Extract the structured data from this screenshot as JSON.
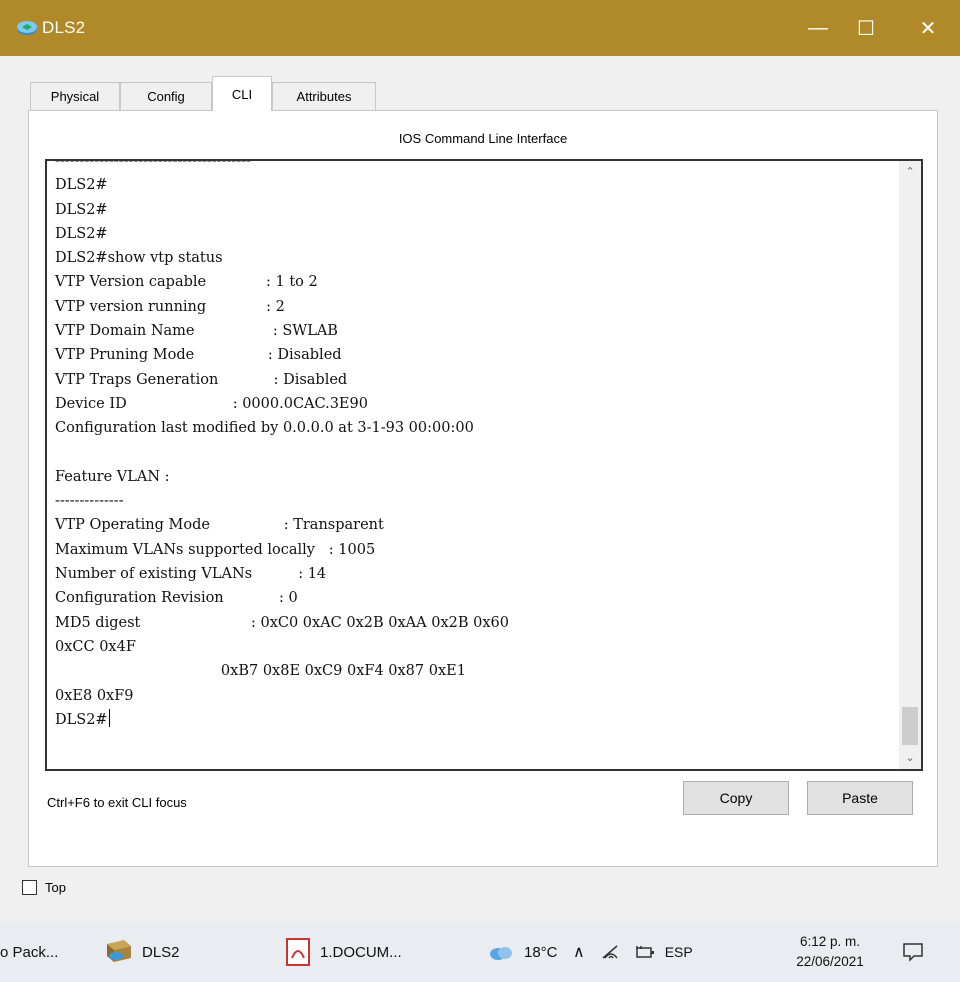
{
  "window": {
    "title": "DLS2",
    "minimize_glyph": "—",
    "maximize_glyph": "☐",
    "close_glyph": "✕"
  },
  "tabs": [
    {
      "label": "Physical",
      "active": false
    },
    {
      "label": "Config",
      "active": false
    },
    {
      "label": "CLI",
      "active": true
    },
    {
      "label": "Attributes",
      "active": false
    }
  ],
  "cli": {
    "heading": "IOS Command Line Interface",
    "lines": [
      "----------------------------------------",
      "DLS2#",
      "DLS2#",
      "DLS2#",
      "DLS2#show vtp status",
      "VTP Version capable             : 1 to 2",
      "VTP version running             : 2",
      "VTP Domain Name                 : SWLAB",
      "VTP Pruning Mode                : Disabled",
      "VTP Traps Generation            : Disabled",
      "Device ID                       : 0000.0CAC.3E90",
      "Configuration last modified by 0.0.0.0 at 3-1-93 00:00:00",
      "",
      "Feature VLAN :",
      "--------------",
      "VTP Operating Mode                : Transparent",
      "Maximum VLANs supported locally   : 1005",
      "Number of existing VLANs          : 14",
      "Configuration Revision            : 0",
      "MD5 digest                        : 0xC0 0xAC 0x2B 0xAA 0x2B 0x60",
      "0xCC 0x4F",
      "                                    0xB7 0x8E 0xC9 0xF4 0x87 0xE1",
      "0xE8 0xF9",
      "DLS2#"
    ],
    "hint": "Ctrl+F6 to exit CLI focus",
    "copy_label": "Copy",
    "paste_label": "Paste"
  },
  "top_checkbox": {
    "label": "Top",
    "checked": false
  },
  "taskbar": {
    "items": [
      {
        "label": "o Pack...",
        "icon": "app-icon"
      },
      {
        "label": "DLS2",
        "icon": "switch-icon"
      },
      {
        "label": "1.DOCUM...",
        "icon": "pdf-icon"
      }
    ],
    "weather": "18°C",
    "tray_caret": "∧",
    "language": "ESP",
    "time": "6:12 p. m.",
    "date": "22/06/2021"
  },
  "colors": {
    "titlebar": "#b08928",
    "panel": "#ffffff",
    "taskbar": "#e9ecf1"
  }
}
